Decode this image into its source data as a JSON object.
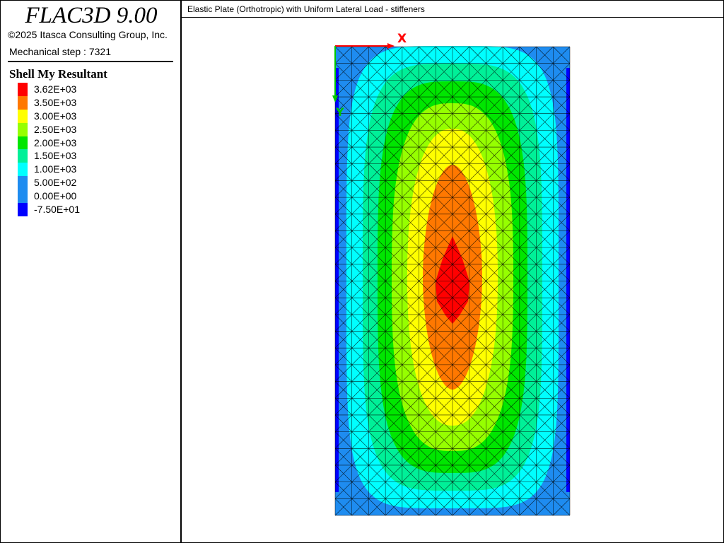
{
  "app": {
    "title": "FLAC3D 9.00",
    "copyright": "©2025 Itasca Consulting Group, Inc.",
    "step": "Mechanical step : 7321"
  },
  "plot": {
    "title": "Elastic Plate (Orthotropic) with Uniform Lateral Load - stiffeners"
  },
  "legend": {
    "title": "Shell My Resultant",
    "items": [
      {
        "label": "3.62E+03",
        "color": "#ff0000"
      },
      {
        "label": "3.50E+03",
        "color": "#ff7800"
      },
      {
        "label": "3.00E+03",
        "color": "#ffff00"
      },
      {
        "label": "2.50E+03",
        "color": "#96ff00"
      },
      {
        "label": "2.00E+03",
        "color": "#00e600"
      },
      {
        "label": "1.50E+03",
        "color": "#00f098"
      },
      {
        "label": "1.00E+03",
        "color": "#00ffff"
      },
      {
        "label": "5.00E+02",
        "color": "#1e8cf0"
      },
      {
        "label": "0.00E+00",
        "color": "#1e8cf0"
      },
      {
        "label": "-7.50E+01",
        "color": "#0000ff"
      }
    ]
  },
  "axes": {
    "x_label": "X",
    "y_label": "Y",
    "x_color": "#ff0000",
    "y_color": "#00c800"
  },
  "mesh": {
    "columns": 14,
    "rows": 28,
    "line_color": "#000000"
  }
}
